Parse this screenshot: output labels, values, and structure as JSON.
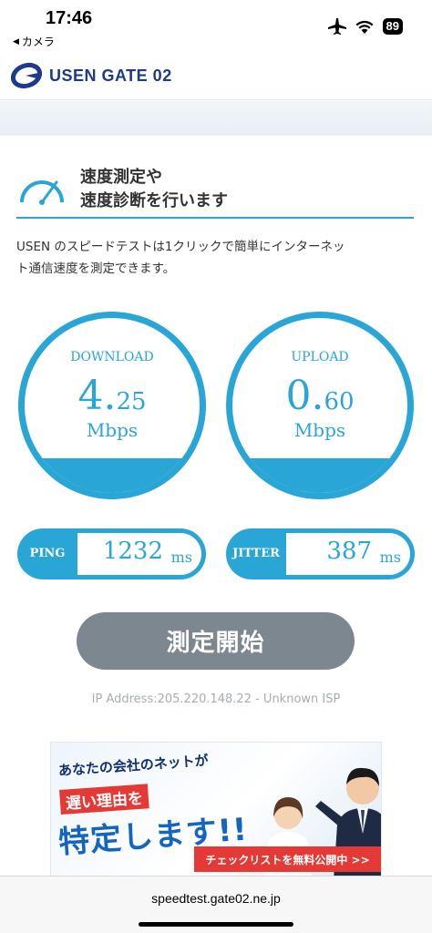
{
  "status_bar": {
    "time": "17:46",
    "back_label": "カメラ",
    "battery": "89",
    "icons": [
      "airplane-icon",
      "wifi-icon",
      "battery-icon"
    ]
  },
  "header": {
    "logo_text": "USEN GATE 02"
  },
  "section": {
    "title_line1": "速度測定や",
    "title_line2": "速度診断を行います",
    "intro_line1": "USEN のスピードテストは1クリックで簡単にインターネッ",
    "intro_line2": "ト通信速度を測定できます。"
  },
  "download": {
    "label": "DOWNLOAD",
    "value_int": "4.",
    "value_dec": "25",
    "unit": "Mbps",
    "fill_fraction": 0.2
  },
  "upload": {
    "label": "UPLOAD",
    "value_int": "0.",
    "value_dec": "60",
    "unit": "Mbps",
    "fill_fraction": 0.2
  },
  "ping": {
    "label": "PING",
    "value": "1232",
    "unit": "ms"
  },
  "jitter": {
    "label": "JITTER",
    "value": "387",
    "unit": "ms"
  },
  "start_button": {
    "label": "測定開始"
  },
  "ip_info": "IP Address:205.220.148.22 - Unknown ISP",
  "banner": {
    "line1": "あなたの会社のネットが",
    "line2": "遅い理由を",
    "line3": "特定します!!",
    "cta": "チェックリストを無料公開中 >>"
  },
  "url_bar": {
    "url": "speedtest.gate02.ne.jp"
  },
  "colors": {
    "accent": "#2aa6d6",
    "button_gray": "#7d878f",
    "brand_navy": "#1e3a8a"
  }
}
